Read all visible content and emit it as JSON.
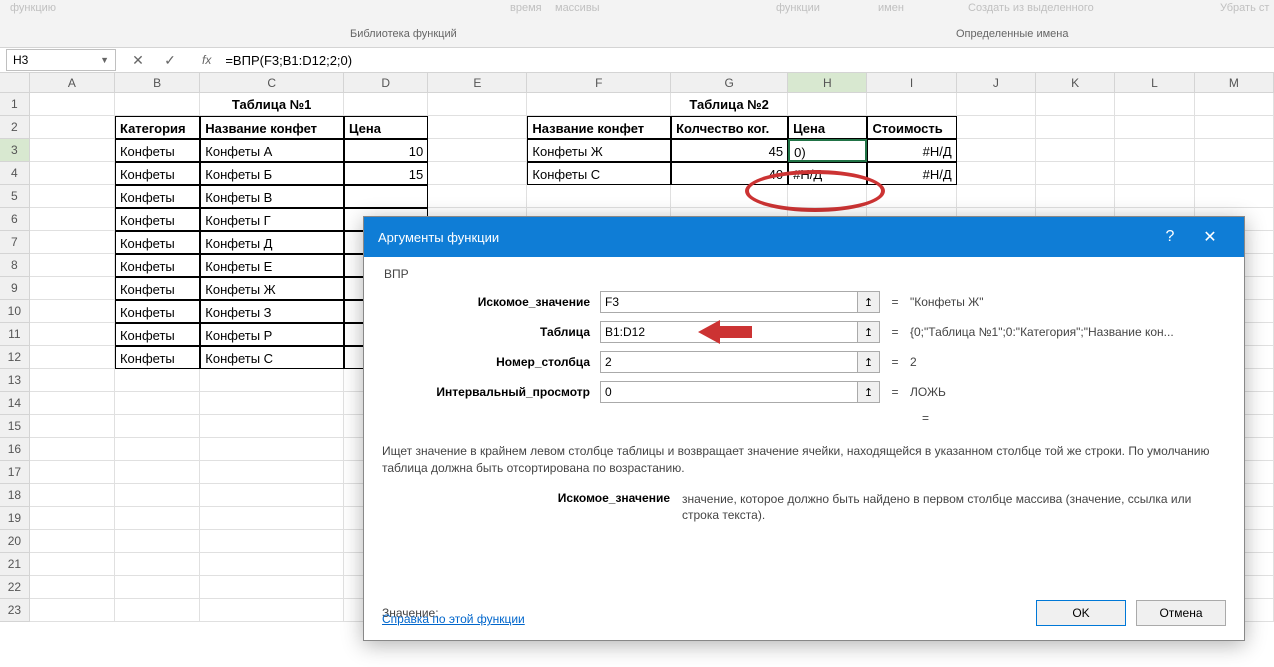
{
  "ribbon": {
    "funcLib": "Библиотека функций",
    "definedNames": "Определенные имена",
    "item1": "функцию",
    "item2": "время",
    "item3": "массивы",
    "item4": "функции",
    "item5": "имен",
    "item6": "Создать из выделенного",
    "item7": "Убрать ст"
  },
  "formulaBar": {
    "nameBox": "H3",
    "fx": "fx",
    "formula": "=ВПР(F3;B1:D12;2;0)"
  },
  "columns": [
    "A",
    "B",
    "C",
    "D",
    "E",
    "F",
    "G",
    "H",
    "I",
    "J",
    "K",
    "L",
    "M"
  ],
  "rows": [
    "1",
    "2",
    "3",
    "4",
    "5",
    "6",
    "7",
    "8",
    "9",
    "10",
    "11",
    "12",
    "13",
    "14",
    "15",
    "16",
    "17",
    "18",
    "19",
    "20",
    "21",
    "22",
    "23"
  ],
  "table1": {
    "title": "Таблица №1",
    "headers": {
      "cat": "Категория",
      "name": "Название конфет",
      "price": "Цена"
    },
    "rows": [
      {
        "cat": "Конфеты",
        "name": "Конфеты А",
        "price": "10"
      },
      {
        "cat": "Конфеты",
        "name": "Конфеты Б",
        "price": "15"
      },
      {
        "cat": "Конфеты",
        "name": "Конфеты В",
        "price": ""
      },
      {
        "cat": "Конфеты",
        "name": "Конфеты Г",
        "price": ""
      },
      {
        "cat": "Конфеты",
        "name": "Конфеты Д",
        "price": ""
      },
      {
        "cat": "Конфеты",
        "name": "Конфеты Е",
        "price": ""
      },
      {
        "cat": "Конфеты",
        "name": "Конфеты Ж",
        "price": ""
      },
      {
        "cat": "Конфеты",
        "name": "Конфеты З",
        "price": ""
      },
      {
        "cat": "Конфеты",
        "name": "Конфеты Р",
        "price": ""
      },
      {
        "cat": "Конфеты",
        "name": "Конфеты С",
        "price": ""
      }
    ]
  },
  "table2": {
    "title": "Таблица №2",
    "headers": {
      "name": "Название конфет",
      "qty": "Колчество ког.",
      "price": "Цена",
      "cost": "Стоимость"
    },
    "rows": [
      {
        "name": "Конфеты Ж",
        "qty": "45",
        "price": "0)",
        "cost": "#Н/Д"
      },
      {
        "name": "Конфеты С",
        "qty": "40",
        "price": "#Н/Д",
        "cost": "#Н/Д"
      }
    ]
  },
  "dialog": {
    "title": "Аргументы функции",
    "funcName": "ВПР",
    "args": {
      "lookup": {
        "label": "Искомое_значение",
        "value": "F3",
        "result": "\"Конфеты Ж\""
      },
      "table": {
        "label": "Таблица",
        "value": "B1:D12",
        "result": "{0;\"Таблица №1\";0:\"Категория\";\"Название кон..."
      },
      "col": {
        "label": "Номер_столбца",
        "value": "2",
        "result": "2"
      },
      "range": {
        "label": "Интервальный_просмотр",
        "value": "0",
        "result": "ЛОЖЬ"
      }
    },
    "eqSign": "=",
    "description": "Ищет значение в крайнем левом столбце таблицы и возвращает значение ячейки, находящейся в указанном столбце той же строки. По умолчанию таблица должна быть отсортирована по возрастанию.",
    "argDescLabel": "Искомое_значение",
    "argDescText": "значение, которое должно быть найдено в первом столбце массива (значение, ссылка или строка текста).",
    "valueLabel": "Значение:",
    "helpLink": "Справка по этой функции",
    "ok": "OK",
    "cancel": "Отмена"
  }
}
